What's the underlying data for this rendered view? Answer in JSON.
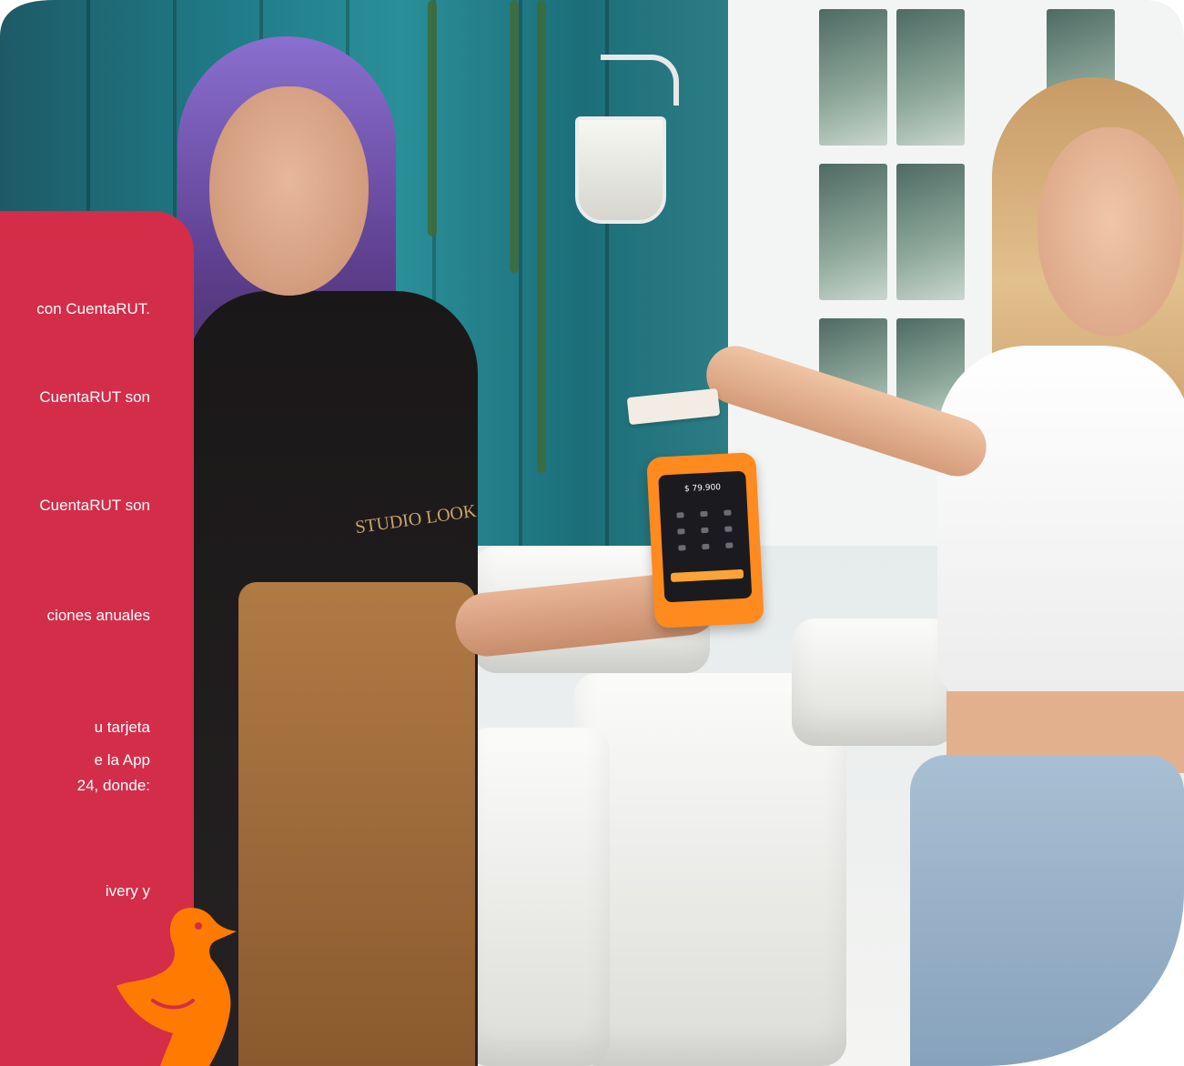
{
  "panel": {
    "lines": [
      "con CuentaRUT.",
      "CuentaRUT son",
      "CuentaRUT son",
      "ciones anuales",
      "u tarjeta",
      "e la App",
      "24, donde:",
      "ivery y"
    ],
    "color": "#d32d4a"
  },
  "terminal": {
    "amount": "$ 79.900",
    "color": "#ff8a1e"
  },
  "apron": {
    "brand": "STUDIO LOOK"
  },
  "mascot": {
    "icon": "duck-mascot-icon",
    "color": "#ff7a00"
  }
}
